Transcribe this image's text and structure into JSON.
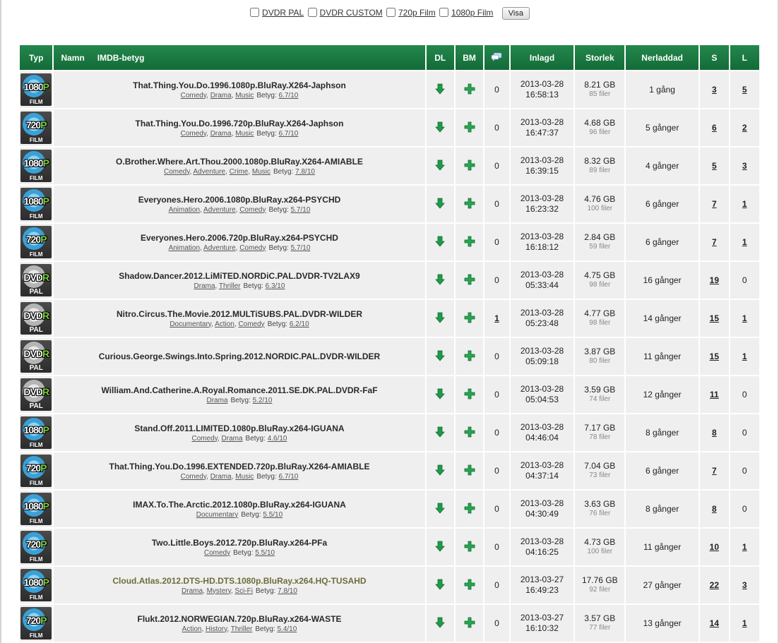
{
  "filters": [
    {
      "label": "DVDR PAL",
      "checked": false
    },
    {
      "label": "DVDR CUSTOM",
      "checked": false
    },
    {
      "label": "720p Film",
      "checked": false
    },
    {
      "label": "1080p Film",
      "checked": false
    }
  ],
  "show_button": "Visa",
  "headers": {
    "type": "Typ",
    "name": "Namn",
    "imdb": "IMDB-betyg",
    "dl": "DL",
    "bm": "BM",
    "comments_icon": "comments-icon",
    "added": "Inlagd",
    "size": "Storlek",
    "snatched": "Nerladdad",
    "seeders": "S",
    "leechers": "L"
  },
  "colors": {
    "header_green": "#1d7a44",
    "row_bg": "#efefef",
    "icon_green": "#1f9a4a"
  },
  "rows": [
    {
      "type": "1080p",
      "title": "That.Thing.You.Do.1996.1080p.BluRay.X264-Japhson",
      "genres": [
        "Comedy",
        "Drama",
        "Music"
      ],
      "betyg_label": "Betyg:",
      "rating": "6.7/10",
      "comments": "0",
      "date": "2013-03-28",
      "time": "16:58:13",
      "size": "8.21 GB",
      "files": "85 filer",
      "snatched": "1 gång",
      "seeders": "3",
      "leechers": "5"
    },
    {
      "type": "720p",
      "title": "That.Thing.You.Do.1996.720p.BluRay.X264-Japhson",
      "genres": [
        "Comedy",
        "Drama",
        "Music"
      ],
      "betyg_label": "Betyg:",
      "rating": "6.7/10",
      "comments": "0",
      "date": "2013-03-28",
      "time": "16:47:37",
      "size": "4.68 GB",
      "files": "96 filer",
      "snatched": "5 gånger",
      "seeders": "6",
      "leechers": "2"
    },
    {
      "type": "1080p",
      "title": "O.Brother.Where.Art.Thou.2000.1080p.BluRay.X264-AMIABLE",
      "genres": [
        "Comedy",
        "Adventure",
        "Crime",
        "Music"
      ],
      "betyg_label": "Betyg:",
      "rating": "7.8/10",
      "comments": "0",
      "date": "2013-03-28",
      "time": "16:39:15",
      "size": "8.32 GB",
      "files": "89 filer",
      "snatched": "4 gånger",
      "seeders": "5",
      "leechers": "3"
    },
    {
      "type": "1080p",
      "title": "Everyones.Hero.2006.1080p.BluRay.x264-PSYCHD",
      "genres": [
        "Animation",
        "Adventure",
        "Comedy"
      ],
      "betyg_label": "Betyg:",
      "rating": "5.7/10",
      "comments": "0",
      "date": "2013-03-28",
      "time": "16:23:32",
      "size": "4.76 GB",
      "files": "100 filer",
      "snatched": "6 gånger",
      "seeders": "7",
      "leechers": "1"
    },
    {
      "type": "720p",
      "title": "Everyones.Hero.2006.720p.BluRay.x264-PSYCHD",
      "genres": [
        "Animation",
        "Adventure",
        "Comedy"
      ],
      "betyg_label": "Betyg:",
      "rating": "5.7/10",
      "comments": "0",
      "date": "2013-03-28",
      "time": "16:18:12",
      "size": "2.84 GB",
      "files": "59 filer",
      "snatched": "6 gånger",
      "seeders": "7",
      "leechers": "1"
    },
    {
      "type": "dvdr",
      "title": "Shadow.Dancer.2012.LiMiTED.NORDiC.PAL.DVDR-TV2LAX9",
      "genres": [
        "Drama",
        "Thriller"
      ],
      "betyg_label": "Betyg:",
      "rating": "6.3/10",
      "comments": "0",
      "date": "2013-03-28",
      "time": "05:33:44",
      "size": "4.75 GB",
      "files": "98 filer",
      "snatched": "16 gånger",
      "seeders": "19",
      "leechers": "0"
    },
    {
      "type": "dvdr",
      "title": "Nitro.Circus.The.Movie.2012.MULTiSUBS.PAL.DVDR-WILDER",
      "genres": [
        "Documentary",
        "Action",
        "Comedy"
      ],
      "betyg_label": "Betyg:",
      "rating": "6.2/10",
      "comments": "1",
      "date": "2013-03-28",
      "time": "05:23:48",
      "size": "4.77 GB",
      "files": "98 filer",
      "snatched": "14 gånger",
      "seeders": "15",
      "leechers": "1"
    },
    {
      "type": "dvdr",
      "title": "Curious.George.Swings.Into.Spring.2012.NORDIC.PAL.DVDR-WILDER",
      "genres": [],
      "betyg_label": "",
      "rating": "",
      "comments": "0",
      "date": "2013-03-28",
      "time": "05:09:18",
      "size": "3.87 GB",
      "files": "80 filer",
      "snatched": "11 gånger",
      "seeders": "15",
      "leechers": "1"
    },
    {
      "type": "dvdr",
      "title": "William.And.Catherine.A.Royal.Romance.2011.SE.DK.PAL.DVDR-FaF",
      "genres": [
        "Drama"
      ],
      "betyg_label": "Betyg:",
      "rating": "5.2/10",
      "comments": "0",
      "date": "2013-03-28",
      "time": "05:04:53",
      "size": "3.59 GB",
      "files": "74 filer",
      "snatched": "12 gånger",
      "seeders": "11",
      "leechers": "0"
    },
    {
      "type": "1080p",
      "title": "Stand.Off.2011.LIMITED.1080p.BluRay.x264-IGUANA",
      "genres": [
        "Comedy",
        "Drama"
      ],
      "betyg_label": "Betyg:",
      "rating": "4.6/10",
      "comments": "0",
      "date": "2013-03-28",
      "time": "04:46:04",
      "size": "7.17 GB",
      "files": "78 filer",
      "snatched": "8 gånger",
      "seeders": "8",
      "leechers": "0"
    },
    {
      "type": "720p",
      "title": "That.Thing.You.Do.1996.EXTENDED.720p.BluRay.X264-AMIABLE",
      "genres": [
        "Comedy",
        "Drama",
        "Music"
      ],
      "betyg_label": "Betyg:",
      "rating": "6.7/10",
      "comments": "0",
      "date": "2013-03-28",
      "time": "04:37:14",
      "size": "7.04 GB",
      "files": "73 filer",
      "snatched": "6 gånger",
      "seeders": "7",
      "leechers": "0"
    },
    {
      "type": "1080p",
      "title": "IMAX.To.The.Arctic.2012.1080p.BluRay.x264-IGUANA",
      "genres": [
        "Documentary"
      ],
      "betyg_label": "Betyg:",
      "rating": "5.5/10",
      "comments": "0",
      "date": "2013-03-28",
      "time": "04:30:49",
      "size": "3.63 GB",
      "files": "76 filer",
      "snatched": "8 gånger",
      "seeders": "8",
      "leechers": "0"
    },
    {
      "type": "720p",
      "title": "Two.Little.Boys.2012.720p.BluRay.x264-PFa",
      "genres": [
        "Comedy"
      ],
      "betyg_label": "Betyg:",
      "rating": "5.5/10",
      "comments": "0",
      "date": "2013-03-28",
      "time": "04:16:25",
      "size": "4.73 GB",
      "files": "100 filer",
      "snatched": "11 gånger",
      "seeders": "10",
      "leechers": "1"
    },
    {
      "type": "1080p",
      "title": "Cloud.Atlas.2012.DTS-HD.DTS.1080p.BluRay.x264.HQ-TUSAHD",
      "title_color": "olive",
      "genres": [
        "Drama",
        "Mystery",
        "Sci-Fi"
      ],
      "betyg_label": "Betyg:",
      "rating": "7.8/10",
      "comments": "0",
      "date": "2013-03-27",
      "time": "16:49:23",
      "size": "17.76 GB",
      "files": "92 filer",
      "snatched": "27 gånger",
      "seeders": "22",
      "leechers": "3"
    },
    {
      "type": "720p",
      "title": "Flukt.2012.NORWEGIAN.720p.BluRay.x264-WASTE",
      "genres": [
        "Action",
        "History",
        "Thriller"
      ],
      "betyg_label": "Betyg:",
      "rating": "5.4/10",
      "comments": "0",
      "date": "2013-03-27",
      "time": "16:10:32",
      "size": "3.57 GB",
      "files": "77 filer",
      "snatched": "13 gånger",
      "seeders": "14",
      "leechers": "1"
    }
  ],
  "format_labels": {
    "1080p": {
      "main": "1080",
      "accent": "P",
      "sub": "FILM"
    },
    "720p": {
      "main": "720",
      "accent": "P",
      "sub": "FILM"
    },
    "dvdr": {
      "main": "DVD",
      "accent": "R",
      "sub": "PAL"
    }
  }
}
